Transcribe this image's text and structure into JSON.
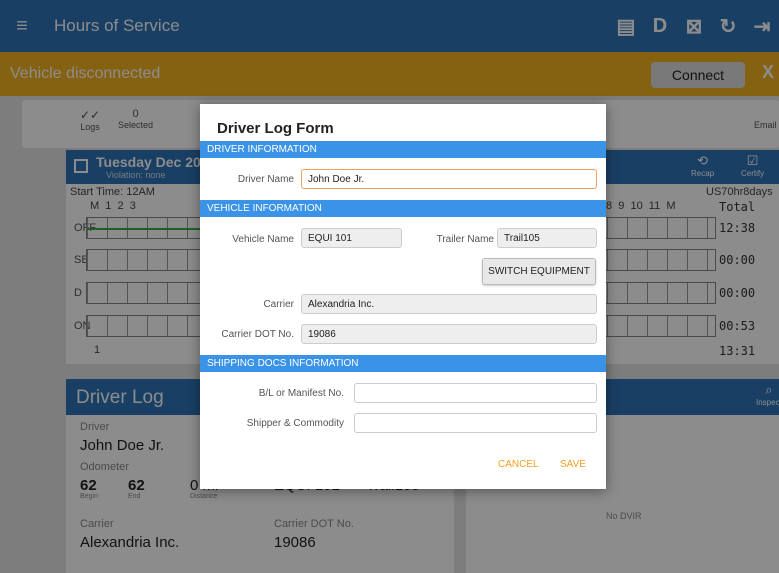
{
  "appbar": {
    "title": "Hours of Service",
    "icons": [
      "chat-icon",
      "d-icon",
      "driver-icon",
      "refresh-icon",
      "logout-icon"
    ]
  },
  "banner": {
    "text": "Vehicle disconnected",
    "connect_label": "Connect",
    "close_label": "X"
  },
  "toolbar": {
    "logs_label": "Logs",
    "selected_count": "0",
    "selected_label": "Selected",
    "email_label": "Email",
    "recap_label": "Recap",
    "certify_label": "Certify",
    "inspect_label": "Inspect"
  },
  "day_header": {
    "day": "Tuesday Dec 20",
    "violation": "Violation: none"
  },
  "grid": {
    "start_time": "Start Time: 12AM",
    "ruleset": "US70hr8days",
    "left_hours": "M  1  2  3",
    "right_hours": "8  9  10  11  M",
    "total_label": "Total",
    "rows": [
      {
        "label": "OFF",
        "total": "12:38"
      },
      {
        "label": "SB",
        "total": "00:00"
      },
      {
        "label": "D",
        "total": "00:00"
      },
      {
        "label": "ON",
        "total": "00:53"
      }
    ],
    "sum": "13:31",
    "bottom_left": "1"
  },
  "driver_log": {
    "title": "Driver Log",
    "driver_label": "Driver",
    "driver_value": "John Doe Jr.",
    "odometer_label": "Odometer",
    "odo_begin": "62",
    "odo_end": "62",
    "odo_begin_label": "Begin",
    "odo_end_label": "End",
    "distance": "0 mi",
    "distance_label": "Distance",
    "vehicle": "EQUI 101",
    "trailer": "Trail105",
    "carrier_label": "Carrier",
    "carrier_value": "Alexandria Inc.",
    "dot_label": "Carrier DOT No.",
    "dot_value": "19086",
    "no_dvir": "No DVIR"
  },
  "dialog": {
    "title": "Driver Log Form",
    "sec_driver": "DRIVER INFORMATION",
    "driver_name_label": "Driver Name",
    "driver_name_value": "John Doe Jr.",
    "sec_vehicle": "VEHICLE INFORMATION",
    "vehicle_name_label": "Vehicle Name",
    "vehicle_name_value": "EQUI 101",
    "trailer_name_label": "Trailer Name",
    "trailer_name_value": "Trail105",
    "switch_label": "SWITCH EQUIPMENT",
    "carrier_label": "Carrier",
    "carrier_value": "Alexandria Inc.",
    "dot_label": "Carrier DOT No.",
    "dot_value": "19086",
    "sec_shipping": "SHIPPING DOCS INFORMATION",
    "bl_label": "B/L or Manifest No.",
    "bl_value": "",
    "shipper_label": "Shipper & Commodity",
    "shipper_value": "",
    "cancel_label": "CANCEL",
    "save_label": "SAVE"
  }
}
